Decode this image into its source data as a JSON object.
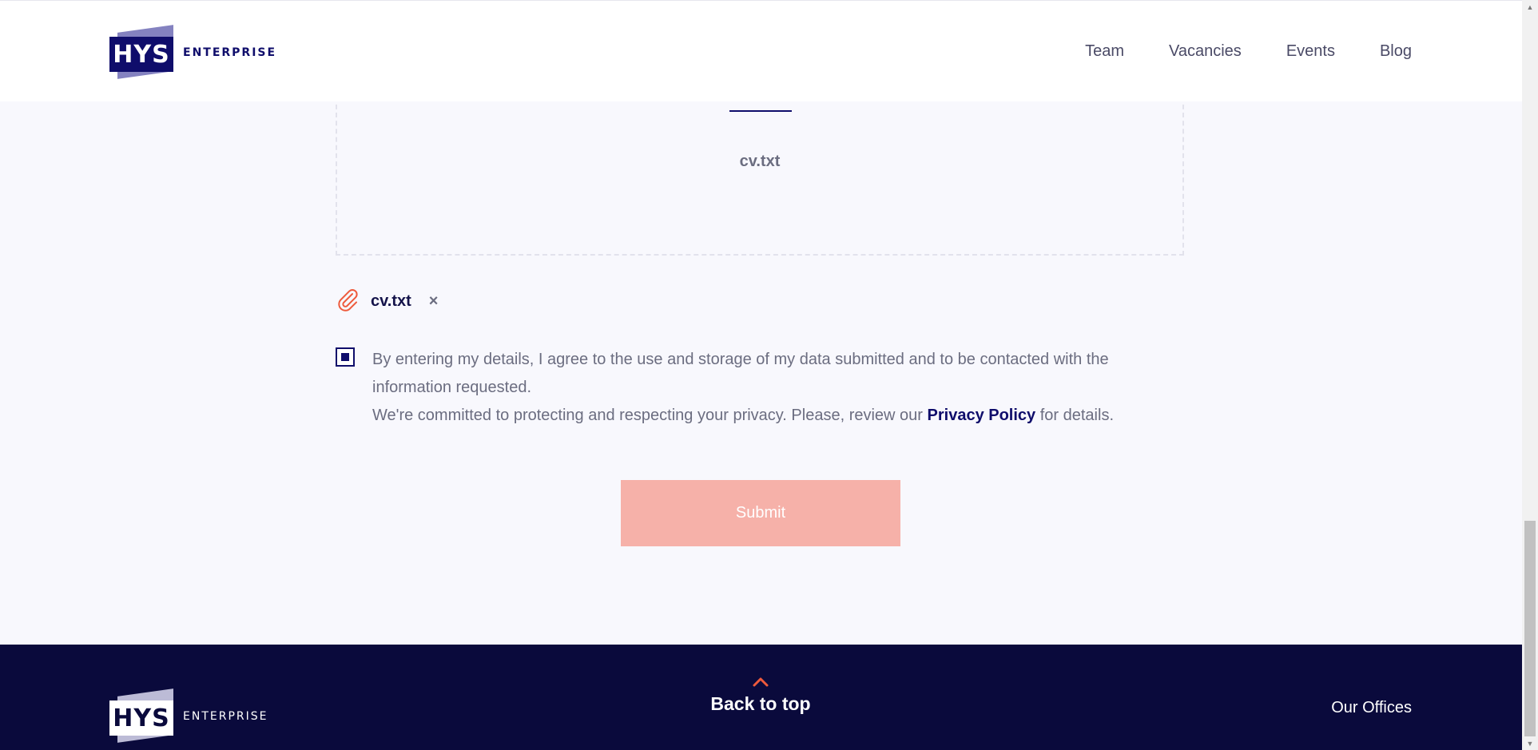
{
  "header": {
    "logo_text": "HYS",
    "logo_subtext": "ENTERPRISE",
    "nav": [
      "Team",
      "Vacancies",
      "Events",
      "Blog"
    ]
  },
  "dropzone": {
    "filename": "cv.txt"
  },
  "attachment": {
    "filename": "cv.txt",
    "remove_label": "×",
    "icon": "paperclip-icon"
  },
  "consent": {
    "checked": true,
    "text_line1": "By entering my details, I agree to the use and storage of my data submitted and to be contacted with the information requested.",
    "text_line2_before": "We're committed to protecting and respecting your privacy. Please, review our ",
    "privacy_link": "Privacy Policy",
    "text_line2_after": " for details."
  },
  "submit": {
    "label": "Submit"
  },
  "footer": {
    "logo_text": "HYS",
    "logo_subtext": "ENTERPRISE",
    "back_to_top": "Back to top",
    "offices": "Our Offices"
  },
  "colors": {
    "brand_navy": "#0f0d6b",
    "footer_bg": "#0a0a3c",
    "accent_orange": "#ee5a3c",
    "submit_bg": "#f6b1a9",
    "page_bg": "#f8f8fd"
  }
}
